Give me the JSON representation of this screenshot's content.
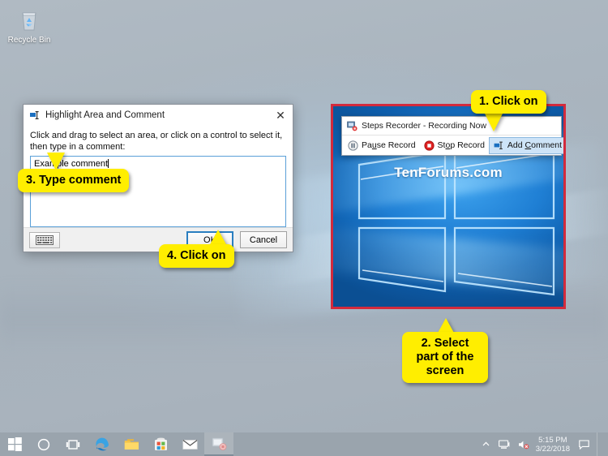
{
  "desktop": {
    "recycle_bin_label": "Recycle Bin"
  },
  "dialog": {
    "title": "Highlight Area and Comment",
    "title_icon": "highlight-comment-icon",
    "close_icon": "close-icon",
    "instruction": "Click and drag to select an area, or click on a control to select it, then type in a comment:",
    "comment_value": "Example comment",
    "comment_placeholder": "",
    "keyboard_icon": "onscreen-keyboard-icon",
    "ok_label": "OK",
    "cancel_label": "Cancel"
  },
  "recorder": {
    "title": "Steps Recorder - Recording Now",
    "app_icon": "steps-recorder-icon",
    "pause_label_pre": "Pa",
    "pause_label_key": "u",
    "pause_label_post": "se Record",
    "stop_label_pre": "St",
    "stop_label_key": "o",
    "stop_label_post": "p Record",
    "add_comment_pre": "Add ",
    "add_comment_key": "C",
    "add_comment_post": "omment",
    "help_icon": "help-icon",
    "dropdown_icon": "chevron-down-icon"
  },
  "selection": {
    "watermark": "TenForums.com",
    "border_color": "#d32a3c"
  },
  "callouts": [
    {
      "id": "step1",
      "text": "1. Click on"
    },
    {
      "id": "step2",
      "text": "2. Select part of the screen"
    },
    {
      "id": "step3",
      "text": "3. Type comment"
    },
    {
      "id": "step4",
      "text": "4. Click on"
    }
  ],
  "callout_text": {
    "step1": "1. Click on",
    "step2_line1": "2. Select",
    "step2_line2": "part of the",
    "step2_line3": "screen",
    "step3": "3. Type comment",
    "step4": "4. Click on"
  },
  "taskbar": {
    "items": [
      {
        "name": "start-button",
        "icon": "windows-logo-icon"
      },
      {
        "name": "cortana-search-button",
        "icon": "circle-icon"
      },
      {
        "name": "task-view-button",
        "icon": "task-view-icon"
      },
      {
        "name": "edge-button",
        "icon": "edge-icon"
      },
      {
        "name": "file-explorer-button",
        "icon": "folder-icon"
      },
      {
        "name": "microsoft-store-button",
        "icon": "store-icon"
      },
      {
        "name": "mail-button",
        "icon": "mail-icon"
      },
      {
        "name": "steps-recorder-button",
        "icon": "steps-recorder-icon"
      }
    ],
    "tray": {
      "chevron_icon": "show-hidden-icons-icon",
      "network_icon": "network-icon",
      "volume_icon": "volume-muted-icon",
      "time": "5:15 PM",
      "date": "3/22/2018",
      "action_center_icon": "action-center-icon"
    }
  },
  "colors": {
    "callout_yellow": "#ffee00",
    "selection_red": "#d32a3c",
    "highlight_blue": "#cde3f7",
    "focus_blue": "#2a7ec0"
  }
}
